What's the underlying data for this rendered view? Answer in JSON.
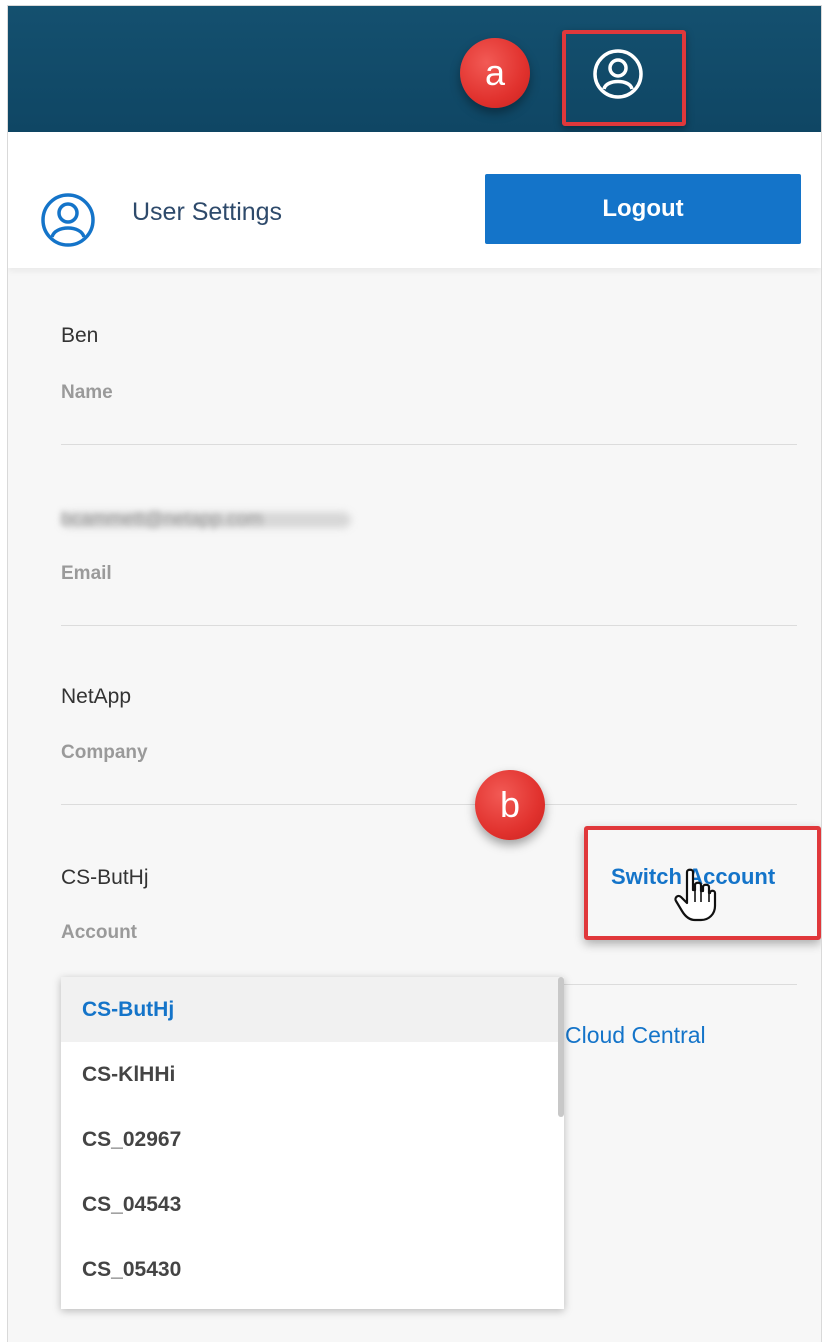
{
  "annotations": {
    "a": "a",
    "b": "b"
  },
  "header": {
    "title": "User Settings",
    "logout_label": "Logout"
  },
  "fields": {
    "name": {
      "value": "Ben",
      "label": "Name"
    },
    "email": {
      "value": "bcammett@netapp.com",
      "label": "Email"
    },
    "company": {
      "value": "NetApp",
      "label": "Company"
    },
    "account": {
      "value": "CS-ButHj",
      "label": "Account"
    }
  },
  "switch_account_label": "Switch Account",
  "cloud_central_link": "Cloud Central",
  "account_options": [
    "CS-ButHj",
    "CS-KlHHi",
    "CS_02967",
    "CS_04543",
    "CS_05430"
  ],
  "selected_account": "CS-ButHj",
  "colors": {
    "topbar": "#14506f",
    "accent": "#1474c9",
    "highlight": "#e0383b"
  },
  "icons": {
    "topbar_user": "user-circle-icon",
    "header_user": "user-circle-icon",
    "cursor": "hand-pointer-icon"
  }
}
